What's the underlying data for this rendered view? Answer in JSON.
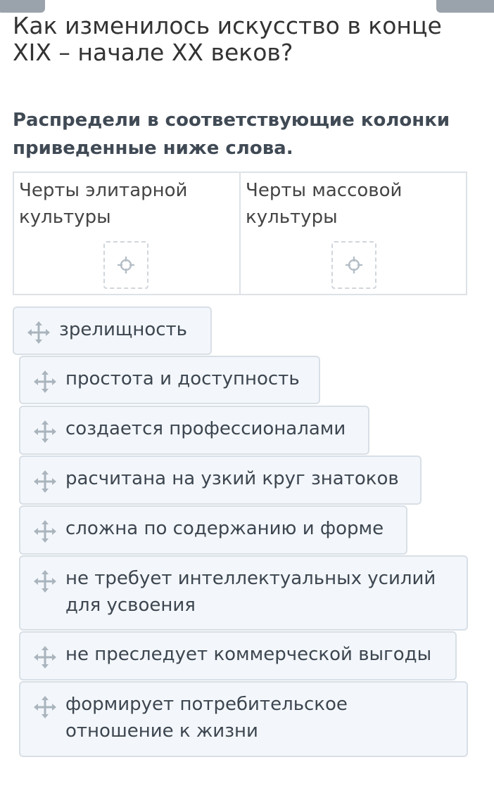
{
  "question": "Как изменилось искусство в конце\nXIX – начале XX веков?",
  "instruction": "Распредели в соответствующие колонки\nприведенные ниже слова.",
  "columns": [
    {
      "title": "Черты элитарной\nкультуры"
    },
    {
      "title": "Черты массовой\nкультуры"
    }
  ],
  "cards": [
    {
      "text": "зрелищность"
    },
    {
      "text": "простота и доступность"
    },
    {
      "text": "создается профессионалами"
    },
    {
      "text": "расчитана на узкий круг знатоков"
    },
    {
      "text": "сложна по содержанию и форме"
    },
    {
      "text": "не требует интеллектуальных усилий для усвоения"
    },
    {
      "text": "не преследует коммерческой выгоды"
    },
    {
      "text": "формирует потребительское отношение к жизни"
    }
  ],
  "icons": {
    "drag_handle": "move-icon",
    "drop_target": "crosshair-icon"
  },
  "colors": {
    "card_bg": "#f3f7fb",
    "card_border": "#d8dfe6",
    "icon": "#aab4bd",
    "text": "#3d4650"
  }
}
